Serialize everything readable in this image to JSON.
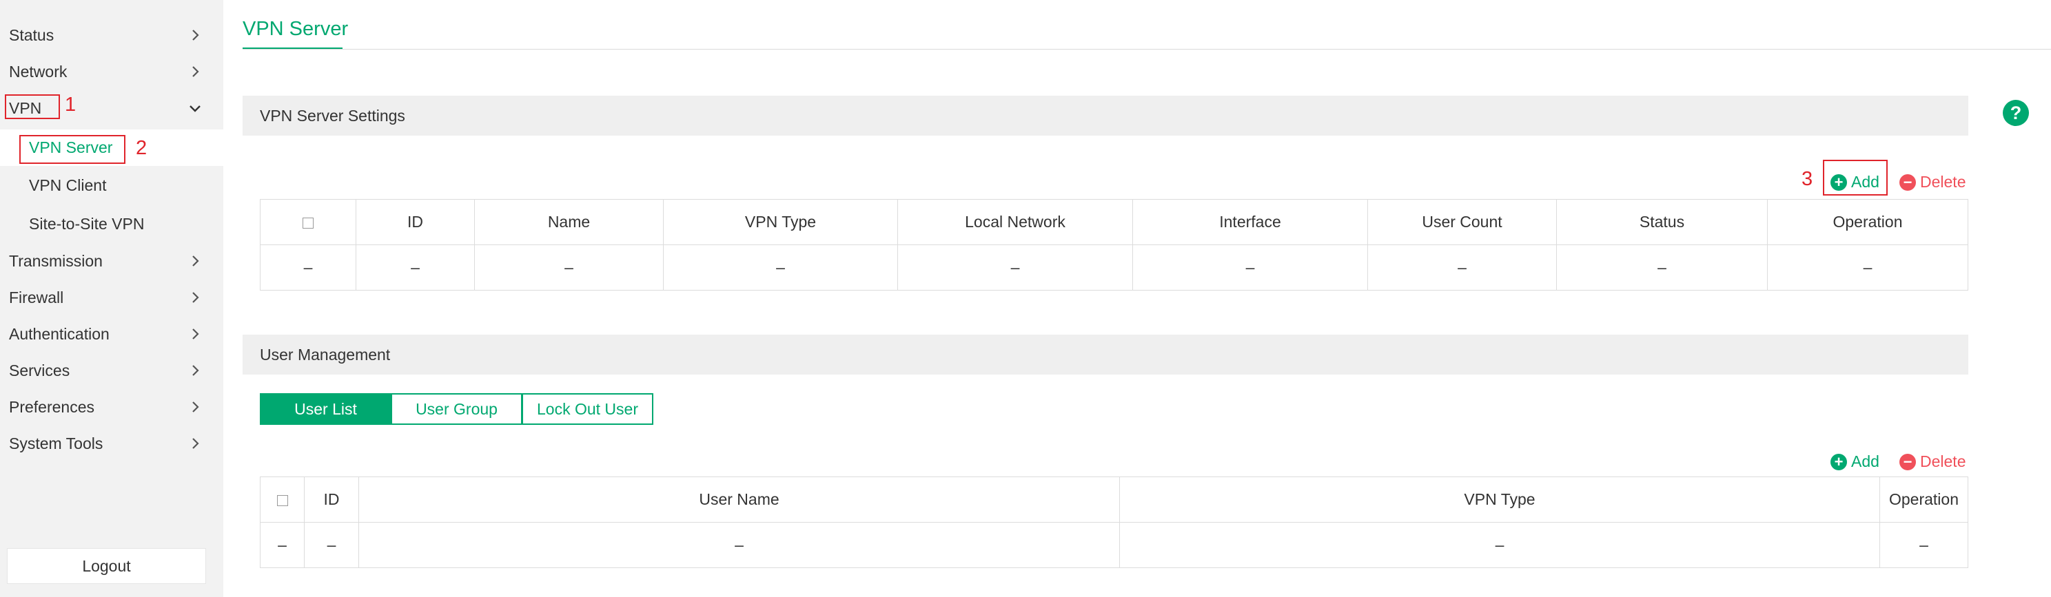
{
  "sidebar": {
    "items": [
      {
        "label": "Status"
      },
      {
        "label": "Network"
      },
      {
        "label": "VPN"
      },
      {
        "label": "VPN Server"
      },
      {
        "label": "VPN Client"
      },
      {
        "label": "Site-to-Site VPN"
      },
      {
        "label": "Transmission"
      },
      {
        "label": "Firewall"
      },
      {
        "label": "Authentication"
      },
      {
        "label": "Services"
      },
      {
        "label": "Preferences"
      },
      {
        "label": "System Tools"
      }
    ],
    "logout_label": "Logout"
  },
  "annotations": {
    "step1": "1",
    "step2": "2",
    "step3": "3"
  },
  "page": {
    "title": "VPN Server"
  },
  "vpn_settings": {
    "title": "VPN Server Settings",
    "add_label": "Add",
    "delete_label": "Delete",
    "columns": [
      "ID",
      "Name",
      "VPN Type",
      "Local Network",
      "Interface",
      "User Count",
      "Status",
      "Operation"
    ],
    "rows": [
      [
        "–",
        "–",
        "–",
        "–",
        "–",
        "–",
        "–",
        "–",
        "–"
      ]
    ]
  },
  "user_management": {
    "title": "User Management",
    "tabs": [
      {
        "label": "User List",
        "active": true
      },
      {
        "label": "User Group",
        "active": false
      },
      {
        "label": "Lock Out User",
        "active": false
      }
    ],
    "add_label": "Add",
    "delete_label": "Delete",
    "columns": [
      "ID",
      "User Name",
      "VPN Type",
      "Operation"
    ],
    "rows": [
      [
        "–",
        "–",
        "–",
        "–",
        "–"
      ]
    ]
  },
  "colors": {
    "accent": "#00a870",
    "danger": "#f0505a",
    "annotation": "#e0242b"
  },
  "icons": {
    "help": "question-icon",
    "chevron": "chevron-right-icon",
    "add": "plus-circle-icon",
    "delete": "minus-circle-icon"
  }
}
